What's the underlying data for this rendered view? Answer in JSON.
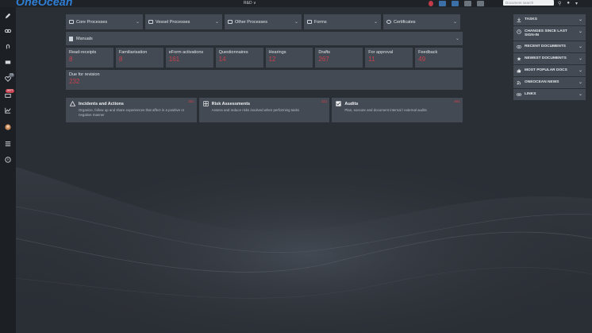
{
  "app": {
    "logo_text": "OneOcean",
    "site": "R&D ∨"
  },
  "top_search": {
    "placeholder": "Document search"
  },
  "sidebar": {
    "badges": {
      "favorites": "73",
      "inbox": "2677"
    }
  },
  "process_tabs": [
    {
      "label": "Core Processes"
    },
    {
      "label": "Vessel Processes"
    },
    {
      "label": "Other Processes"
    },
    {
      "label": "Forms"
    },
    {
      "label": "Certificates"
    }
  ],
  "manuals": {
    "label": "Manuals"
  },
  "stats": [
    {
      "label": "Read-receipts",
      "value": "8"
    },
    {
      "label": "Familiarisation",
      "value": "8"
    },
    {
      "label": "eForm activations",
      "value": "161"
    },
    {
      "label": "Questionnaires",
      "value": "14"
    },
    {
      "label": "Hearings",
      "value": "12"
    },
    {
      "label": "Drafts",
      "value": "267"
    },
    {
      "label": "For approval",
      "value": "11"
    },
    {
      "label": "Feedback",
      "value": "49"
    }
  ],
  "revision": {
    "label": "Due for revision",
    "value": "232"
  },
  "cards": [
    {
      "title": "Incidents and Actions",
      "desc": "Organize, follow up and share experiences that affect in a positive or negative manner",
      "count": "301"
    },
    {
      "title": "Risk Assessments",
      "desc": "Assess and reduce risks involved when performing tasks",
      "count": "331"
    },
    {
      "title": "Audits",
      "desc": "Plan, execute and document internal / external audits",
      "count": "691"
    }
  ],
  "right_panel": [
    {
      "label": "TASKS",
      "icon": "download-icon"
    },
    {
      "label": "CHANGES SINCE LAST SIGN-IN",
      "icon": "clock-icon"
    },
    {
      "label": "RECENT DOCUMENTS",
      "icon": "eye-icon"
    },
    {
      "label": "NEWEST DOCUMENTS",
      "icon": "star-icon"
    },
    {
      "label": "MOST POPULAR DOCS",
      "icon": "thumbs-up-icon"
    },
    {
      "label": "ONEOCEAN NEWS",
      "icon": "rss-icon"
    },
    {
      "label": "LINKS",
      "icon": "link-icon"
    }
  ],
  "colors": {
    "accent": "#2f7fd6",
    "alert": "#c9404e",
    "tile": "#434a53",
    "sidebar": "#1c2025"
  }
}
